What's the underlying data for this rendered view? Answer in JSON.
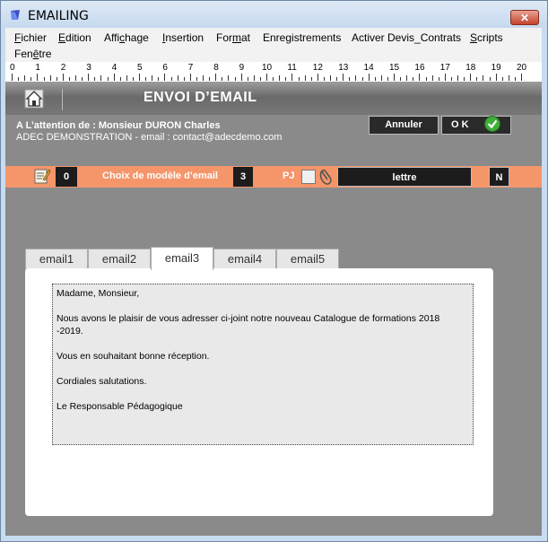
{
  "window": {
    "title": "EMAILING",
    "close_label": "✕"
  },
  "menu": [
    {
      "pre": "",
      "u": "F",
      "post": "ichier"
    },
    {
      "pre": "",
      "u": "E",
      "post": "dition"
    },
    {
      "pre": "Affi",
      "u": "c",
      "post": "hage"
    },
    {
      "pre": "",
      "u": "I",
      "post": "nsertion"
    },
    {
      "pre": "For",
      "u": "m",
      "post": "at"
    },
    {
      "pre": "Enre",
      "u": "g",
      "post": "istrements"
    },
    {
      "pre": "Activer Devis_Contrats",
      "u": "",
      "post": ""
    },
    {
      "pre": "",
      "u": "S",
      "post": "cripts"
    },
    {
      "pre": "Fen",
      "u": "ê",
      "post": "tre"
    }
  ],
  "ruler": [
    "0",
    "1",
    "2",
    "3",
    "4",
    "5",
    "6",
    "7",
    "8",
    "9",
    "10",
    "11",
    "12",
    "13",
    "14",
    "15",
    "16",
    "17",
    "18",
    "19",
    "20"
  ],
  "header": {
    "title": "ENVOI D’EMAIL"
  },
  "recipient": {
    "line1": "A L’attention de : Monsieur DURON Charles",
    "line2": "ADEC DEMONSTRATION - email : contact@adecdemo.com"
  },
  "buttons": {
    "cancel": "Annuler",
    "ok": "O K"
  },
  "toolbar": {
    "count_left": "0",
    "model_label": "Choix de modèle d’email",
    "model_value": "3",
    "pj_label": "PJ",
    "attachment_name": "lettre",
    "flag": "N"
  },
  "tabs": [
    {
      "label": "email1",
      "active": false
    },
    {
      "label": "email2",
      "active": false
    },
    {
      "label": "email3",
      "active": true
    },
    {
      "label": "email4",
      "active": false
    },
    {
      "label": "email5",
      "active": false
    }
  ],
  "body": {
    "greeting": "Madame, Monsieur,",
    "para1": "Nous avons le plaisir de vous adresser ci-joint notre nouveau Catalogue de formations 2018",
    "para1b": "-2019.",
    "para2": "Vous en souhaitant bonne réception.",
    "para3": "Cordiales salutations.",
    "signature": "Le Responsable Pédagogique"
  }
}
